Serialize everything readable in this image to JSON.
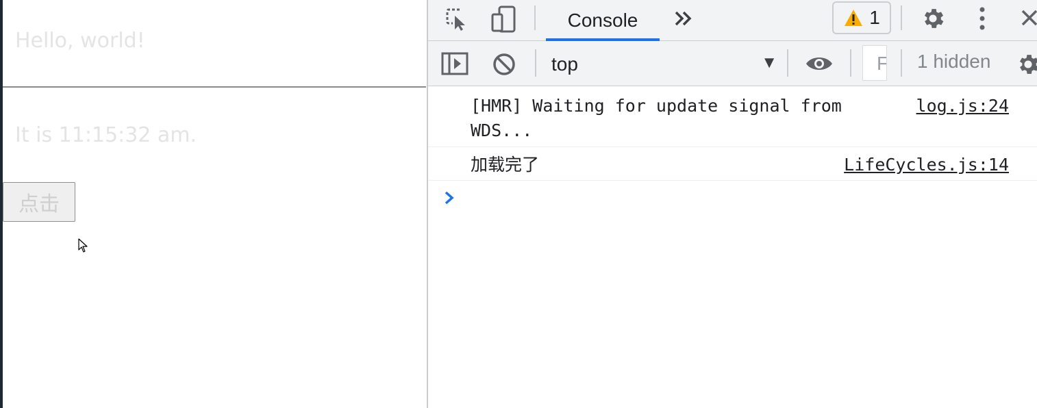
{
  "page": {
    "faded_text_1": "Hello, world!",
    "faded_text_2": "It is 11:15:32 am.",
    "button_label": "点击"
  },
  "devtools": {
    "tabs": {
      "active_label": "Console"
    },
    "warnings_count": "1",
    "toolbar": {
      "context": "top",
      "filter_placeholder": "Filter",
      "hidden_count": "1 hidden"
    },
    "messages": [
      {
        "text": "[HMR] Waiting for update signal from WDS...",
        "source": "log.js:24"
      },
      {
        "text": "加载完了",
        "source": "LifeCycles.js:14"
      }
    ],
    "colors": {
      "accent": "#1a73e8",
      "warning": "#f9ab00",
      "prompt": "#1a73e8"
    },
    "icons": [
      "inspect-element-icon",
      "device-toolbar-icon",
      "more-tabs-icon",
      "warning-icon",
      "settings-gear-icon",
      "kebab-menu-icon",
      "close-icon",
      "sidebar-toggle-icon",
      "clear-console-icon",
      "dropdown-arrow-icon",
      "live-expression-eye-icon",
      "console-settings-icon",
      "prompt-chevron-icon",
      "mouse-cursor-icon"
    ]
  }
}
